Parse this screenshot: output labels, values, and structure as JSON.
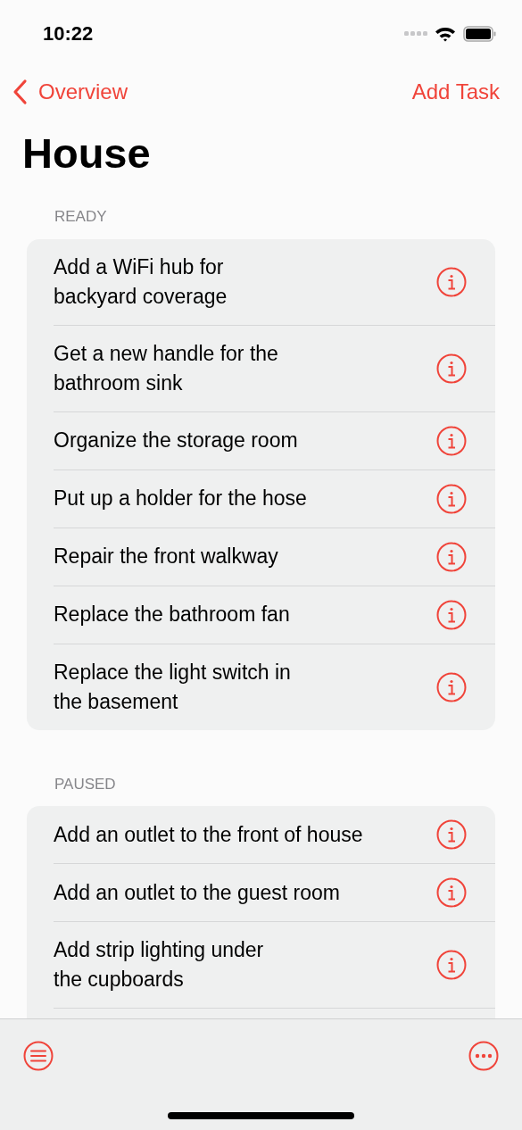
{
  "status_bar": {
    "time": "10:22"
  },
  "nav": {
    "back": "Overview",
    "action": "Add Task"
  },
  "title": "House",
  "sections": [
    {
      "header": "READY",
      "tasks": [
        "Add a WiFi hub for\nbackyard coverage",
        "Get a new handle for the\nbathroom sink",
        "Organize the storage room",
        "Put up a holder for the hose",
        "Repair the front walkway",
        "Replace the bathroom fan",
        "Replace the light switch in\nthe basement"
      ],
      "continues": false
    },
    {
      "header": "PAUSED",
      "tasks": [
        "Add an outlet to the front of house",
        "Add an outlet to the guest room",
        "Add strip lighting under\nthe cupboards"
      ],
      "continues": true
    }
  ]
}
